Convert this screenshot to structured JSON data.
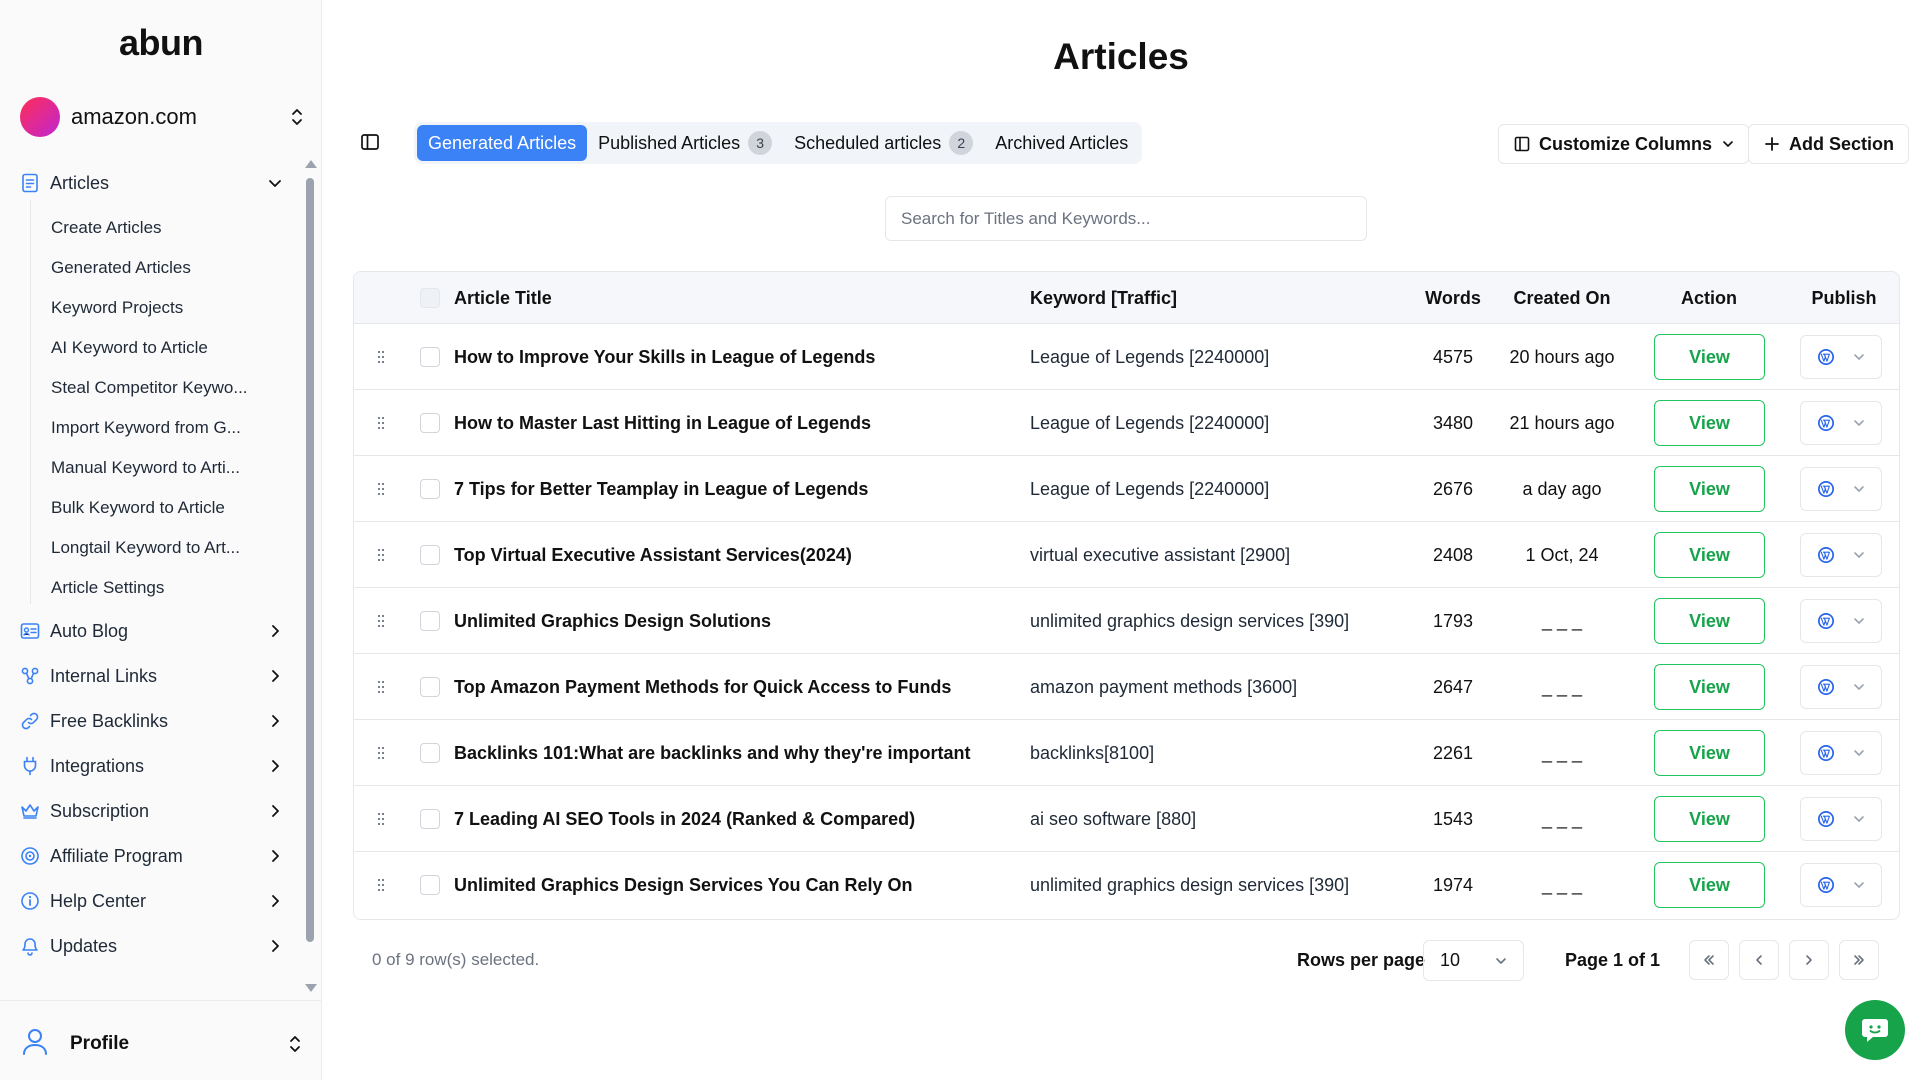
{
  "brand": {
    "logo": "abun"
  },
  "site": {
    "name": "amazon.com"
  },
  "sidebar": {
    "articles_label": "Articles",
    "sub_items": [
      "Create Articles",
      "Generated Articles",
      "Keyword Projects",
      "AI Keyword to Article",
      "Steal Competitor Keywo...",
      "Import Keyword from G...",
      "Manual Keyword to Arti...",
      "Bulk Keyword to Article",
      "Longtail Keyword to Art...",
      "Article Settings"
    ],
    "items": [
      {
        "label": "Auto Blog",
        "icon": "auto-blog-icon"
      },
      {
        "label": "Internal Links",
        "icon": "internal-links-icon"
      },
      {
        "label": "Free Backlinks",
        "icon": "link-icon"
      },
      {
        "label": "Integrations",
        "icon": "plug-icon"
      },
      {
        "label": "Subscription",
        "icon": "crown-icon"
      },
      {
        "label": "Affiliate Program",
        "icon": "affiliate-icon"
      },
      {
        "label": "Help Center",
        "icon": "info-icon"
      },
      {
        "label": "Updates",
        "icon": "bell-icon"
      }
    ],
    "profile_label": "Profile"
  },
  "page": {
    "title": "Articles"
  },
  "tabs": [
    {
      "label": "Generated Articles",
      "badge": ""
    },
    {
      "label": "Published Articles",
      "badge": "3"
    },
    {
      "label": "Scheduled articles",
      "badge": "2"
    },
    {
      "label": "Archived Articles",
      "badge": ""
    }
  ],
  "toolbar": {
    "customize_label": "Customize Columns",
    "add_section_label": "Add Section"
  },
  "search": {
    "placeholder": "Search for Titles and Keywords...",
    "value": ""
  },
  "table": {
    "headers": {
      "title": "Article Title",
      "keyword": "Keyword [Traffic]",
      "words": "Words",
      "created": "Created On",
      "action": "Action",
      "publish": "Publish"
    },
    "action_label": "View",
    "rows": [
      {
        "title": "How to Improve Your Skills in League of Legends",
        "keyword": "League of Legends [2240000]",
        "words": "4575",
        "created": "20 hours ago"
      },
      {
        "title": "How to Master Last Hitting in League of Legends",
        "keyword": "League of Legends [2240000]",
        "words": "3480",
        "created": "21 hours ago"
      },
      {
        "title": "7 Tips for Better Teamplay in League of Legends",
        "keyword": "League of Legends [2240000]",
        "words": "2676",
        "created": "a day ago"
      },
      {
        "title": "Top Virtual Executive Assistant Services(2024)",
        "keyword": "virtual executive assistant [2900]",
        "words": "2408",
        "created": "1 Oct, 24"
      },
      {
        "title": "Unlimited Graphics Design Solutions",
        "keyword": "unlimited graphics design services [390]",
        "words": "1793",
        "created": "_ _ _"
      },
      {
        "title": "Top Amazon Payment Methods for Quick Access to Funds",
        "keyword": "amazon payment methods [3600]",
        "words": "2647",
        "created": "_ _ _"
      },
      {
        "title": "Backlinks 101:What are backlinks and why they're important",
        "keyword": "backlinks[8100]",
        "words": "2261",
        "created": "_ _ _"
      },
      {
        "title": "7 Leading AI SEO Tools in 2024 (Ranked & Compared)",
        "keyword": "ai seo software [880]",
        "words": "1543",
        "created": "_ _ _"
      },
      {
        "title": "Unlimited Graphics Design Services You Can Rely On",
        "keyword": "unlimited graphics design services [390]",
        "words": "1974",
        "created": "_ _ _"
      }
    ]
  },
  "footer": {
    "selected_text": "0 of 9 row(s) selected.",
    "rows_per_page_label": "Rows per page",
    "rows_per_page_value": "10",
    "page_text": "Page 1 of 1"
  },
  "colors": {
    "accent": "#3b82f6",
    "success": "#16a34a",
    "wordpress": "#2563eb"
  }
}
